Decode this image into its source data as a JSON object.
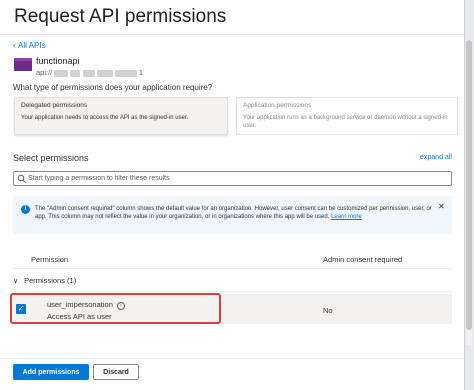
{
  "header": {
    "title": "Request API permissions"
  },
  "nav": {
    "back_label": "All APIs"
  },
  "api": {
    "name": "functionapi",
    "uri_prefix": "api://",
    "uri_suffix": "1",
    "icon": "app-icon"
  },
  "question": "What type of permissions does your application require?",
  "permission_types": [
    {
      "title": "Delegated permissions",
      "description": "Your application needs to access the API as the signed-in user.",
      "selected": true
    },
    {
      "title": "Application permissions",
      "description": "Your application runs as a background service or daemon without a signed-in user.",
      "selected": false
    }
  ],
  "select_section": {
    "label": "Select permissions",
    "expand_all": "expand all",
    "search_placeholder": "Start typing a permission to filter these results"
  },
  "info_banner": {
    "text": "The \"Admin consent required\" column shows the default value for an organization. However, user consent can be customized per permission, user, or app. This column may not reflect the value in your organization, or in organizations where this app will be used.",
    "link": "Learn more",
    "close": "✕"
  },
  "table": {
    "headers": [
      "Permission",
      "Admin consent required"
    ],
    "group": {
      "label": "Permissions (1)",
      "expanded": true
    },
    "rows": [
      {
        "name": "user_impersonation",
        "description": "Access API as user",
        "admin_consent": "No",
        "checked": true
      }
    ]
  },
  "footer": {
    "primary": "Add permissions",
    "secondary": "Discard"
  },
  "colors": {
    "accent": "#0078d4",
    "highlight": "#e03a3a",
    "api_icon": "#6b2d8a"
  }
}
